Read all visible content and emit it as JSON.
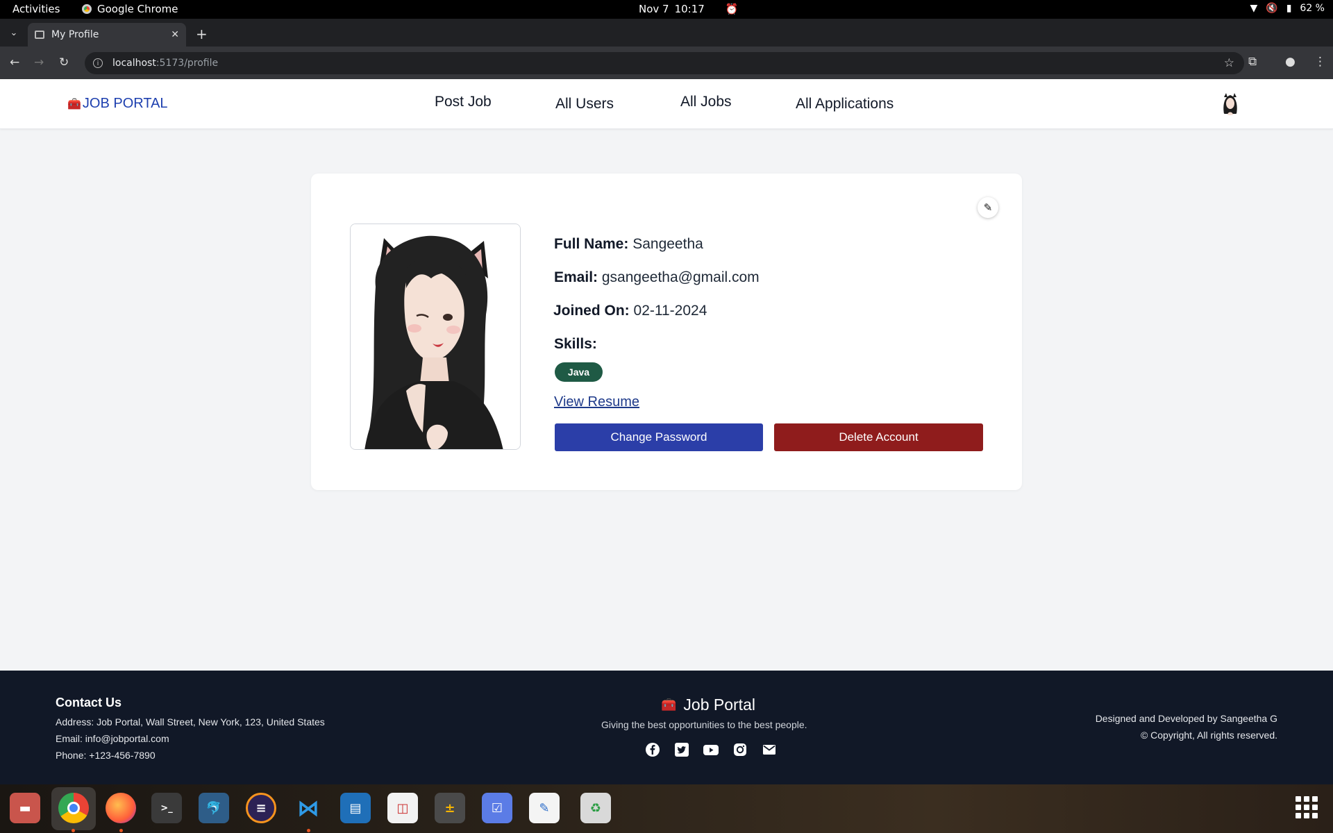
{
  "system_bar": {
    "activities": "Activities",
    "app_name": "Google Chrome",
    "date": "Nov 7",
    "time": "10:17",
    "battery": "62 %"
  },
  "browser": {
    "tab_title": "My Profile",
    "url_host": "localhost",
    "url_path": ":5173/profile"
  },
  "header": {
    "brand": "JOB PORTAL",
    "nav": [
      {
        "label": "Post Job"
      },
      {
        "label": "All Users"
      },
      {
        "label": "All Jobs"
      },
      {
        "label": "All Applications"
      }
    ]
  },
  "profile": {
    "full_name_label": "Full Name:",
    "full_name": "Sangeetha",
    "email_label": "Email:",
    "email": "gsangeetha@gmail.com",
    "joined_label": "Joined On:",
    "joined": "02-11-2024",
    "skills_label": "Skills:",
    "skills": [
      "Java"
    ],
    "resume_link": "View Resume",
    "change_password": "Change Password",
    "delete_account": "Delete Account",
    "colors": {
      "primary_button": "#2b3ea8",
      "danger_button": "#8f1c1c",
      "skill_badge": "#1f5a45",
      "brand": "#1e40af"
    }
  },
  "footer": {
    "contact_title": "Contact Us",
    "address": "Address: Job Portal, Wall Street, New York, 123, United States",
    "email": "Email: info@jobportal.com",
    "phone": "Phone: +123-456-7890",
    "brand": "Job Portal",
    "tagline": "Giving the best opportunities to the best people.",
    "social_icons": [
      "facebook-icon",
      "twitter-icon",
      "youtube-icon",
      "instagram-icon",
      "mail-icon"
    ],
    "credit": "Designed and Developed by Sangeetha G",
    "copyright": "© Copyright, All rights reserved."
  },
  "dock": {
    "apps": [
      "files",
      "google-chrome",
      "firefox",
      "terminal",
      "mysql-workbench",
      "eclipse",
      "vscode",
      "document-viewer",
      "libreoffice-impress",
      "calculator",
      "tasks",
      "text-editor",
      "trash"
    ]
  }
}
